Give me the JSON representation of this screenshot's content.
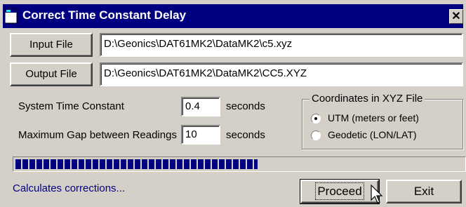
{
  "window": {
    "title": "Correct Time Constant Delay",
    "close_glyph": "✕"
  },
  "files": {
    "input_button_label": "Input File",
    "input_path": "D:\\Geonics\\DAT61MK2\\DataMK2\\c5.xyz",
    "output_button_label": "Output File",
    "output_path": "D:\\Geonics\\DAT61MK2\\DataMK2\\CC5.XYZ"
  },
  "params": {
    "time_constant_label": "System Time Constant",
    "time_constant_value": "0.4",
    "time_constant_unit": "seconds",
    "max_gap_label": "Maximum Gap between Readings",
    "max_gap_value": "10",
    "max_gap_unit": "seconds"
  },
  "coordinates": {
    "group_title": "Coordinates in XYZ File",
    "options": [
      {
        "label": "UTM (meters or feet)",
        "selected": true
      },
      {
        "label": "Geodetic (LON/LAT)",
        "selected": false
      }
    ]
  },
  "progress": {
    "fraction": 0.54
  },
  "status": {
    "text": "Calculates corrections..."
  },
  "buttons": {
    "proceed_label": "Proceed",
    "exit_label": "Exit"
  },
  "icons": {
    "app": "app-window-icon",
    "cursor": "mouse-pointer-icon"
  }
}
